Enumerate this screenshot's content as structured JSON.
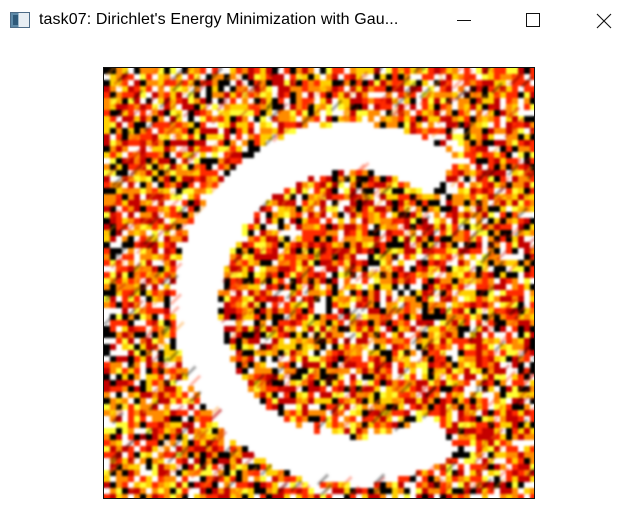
{
  "window": {
    "title": "task07: Dirichlet's Energy Minimization with Gau...",
    "icon": "app-window-icon",
    "controls": {
      "minimize_icon": "minimize-icon",
      "maximize_icon": "maximize-icon",
      "close_icon": "close-icon"
    }
  },
  "render": {
    "description_icon": "noise-texture-render",
    "palette": [
      "#000000",
      "#c40000",
      "#ff2a00",
      "#ff8c00",
      "#ffd000",
      "#ffff33",
      "#ffffff"
    ]
  }
}
